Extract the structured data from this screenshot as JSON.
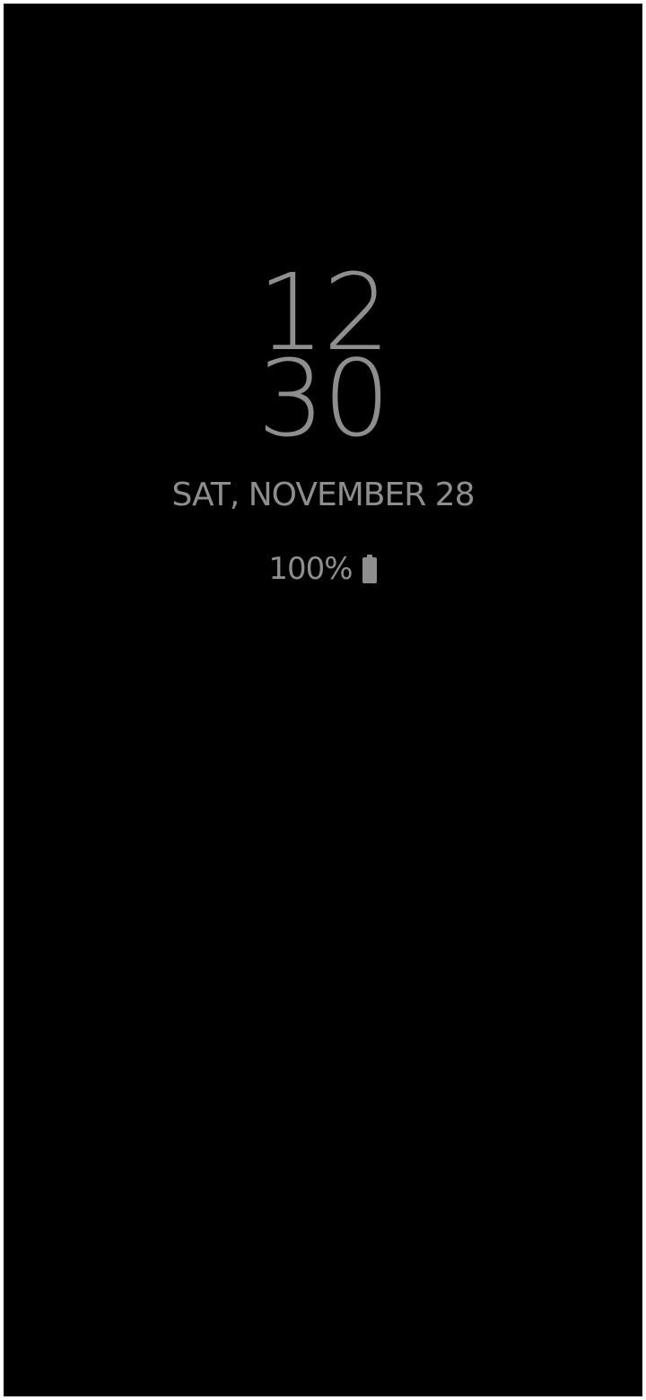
{
  "lock_screen": {
    "clock": {
      "hours": "12",
      "minutes": "30"
    },
    "date": "SAT, NOVEMBER 28",
    "battery": {
      "percent_label": "100%",
      "level": 1.0,
      "icon": "battery-full-icon"
    },
    "colors": {
      "background": "#000000",
      "text": "#8e8e8e"
    }
  }
}
